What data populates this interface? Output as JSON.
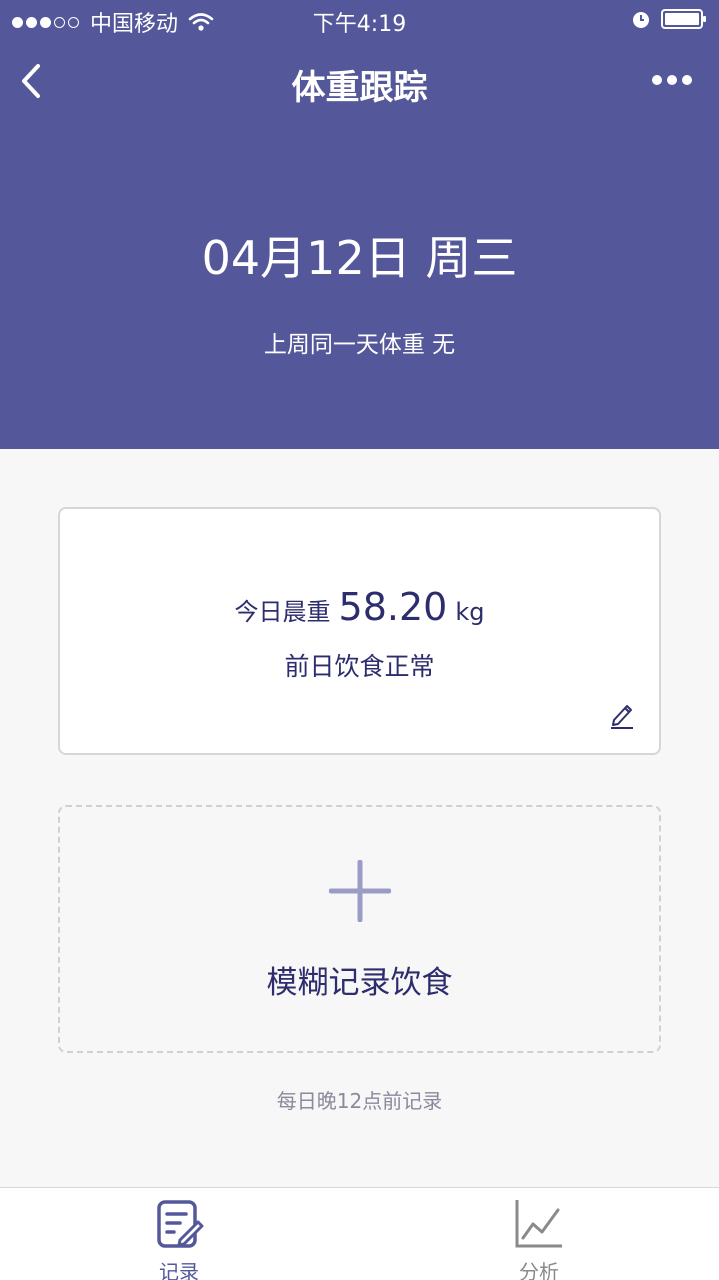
{
  "status_bar": {
    "carrier": "中国移动",
    "time": "下午4:19"
  },
  "nav": {
    "title": "体重跟踪"
  },
  "header": {
    "date": "04月12日 周三",
    "last_week": "上周同一天体重 无"
  },
  "weight_card": {
    "label": "今日晨重",
    "value": "58.20",
    "unit": "kg",
    "diet_status": "前日饮食正常"
  },
  "add_card": {
    "label": "模糊记录饮食"
  },
  "hint": "每日晚12点前记录",
  "tabs": [
    {
      "label": "记录",
      "icon": "record-icon",
      "active": true
    },
    {
      "label": "分析",
      "icon": "chart-icon",
      "active": false
    }
  ],
  "colors": {
    "primary": "#54589b",
    "text": "#2d2d6e",
    "background": "#f7f7f7"
  }
}
